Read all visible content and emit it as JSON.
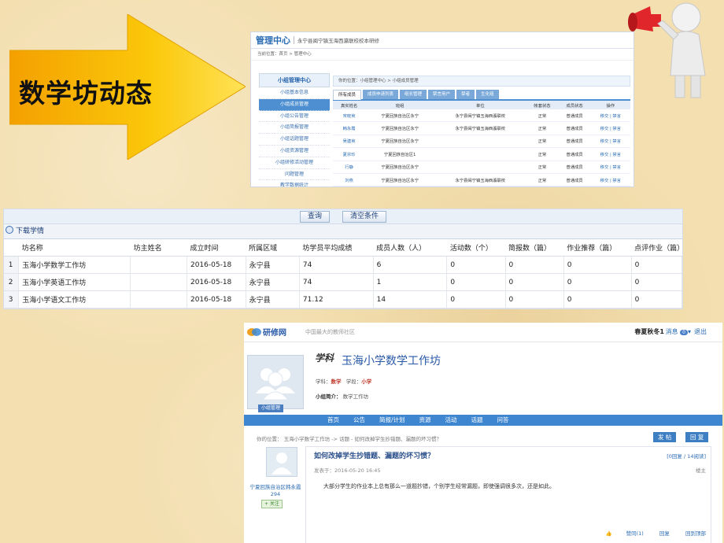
{
  "slide": {
    "title": "数学坊动态"
  },
  "panel_admin": {
    "header_title": "管理中心",
    "header_subtitle": "永宁县闽宁镇玉海西瀛联校校本研修",
    "breadcrumb": "当前位置：首页 > 管理中心",
    "sidebar_head": "小组管理中心",
    "sidebar_items": [
      "小组基本信息",
      "小组成员管理",
      "小组公告管理",
      "小组简报管理",
      "小组话题管理",
      "小组资源管理",
      "小组研修活动管理",
      "问题管理",
      "教学数据统计"
    ],
    "location": "你的位置：小组管理中心 > 小组成员管理",
    "tabs": [
      "所有成员",
      "成员申请列表",
      "组长管理",
      "禁言用户",
      "禁者",
      "生化组"
    ],
    "columns": [
      "真实姓名",
      "班组",
      "单位",
      "帐套状态",
      "成员状态",
      "操作"
    ],
    "rows": [
      {
        "name": "宋晓英",
        "dept": "宁夏回族自治区永宁",
        "org": "永宁县闽宁镇玉海西瀛联校",
        "status": "正常",
        "role": "普通成员",
        "op": "移交 | 禁言"
      },
      {
        "name": "韩永霞",
        "dept": "宁夏回族自治区永宁",
        "org": "永宁县闽宁镇玉海西瀛联校",
        "status": "正常",
        "role": "普通成员",
        "op": "移交 | 禁言"
      },
      {
        "name": "吴建英",
        "dept": "宁夏回族自治区永宁",
        "org": "",
        "status": "正常",
        "role": "普通成员",
        "op": "移交 | 禁言"
      },
      {
        "name": "夏宗珍",
        "dept": "宁夏回族自治区1",
        "org": "",
        "status": "正常",
        "role": "普通成员",
        "op": "移交 | 禁言"
      },
      {
        "name": "行静",
        "dept": "宁夏回族自治区永宁",
        "org": "",
        "status": "正常",
        "role": "普通成员",
        "op": "移交 | 禁言"
      },
      {
        "name": "刘燕",
        "dept": "宁夏回族自治区永宁",
        "org": "永宁县闽宁镇玉海西瀛联校",
        "status": "正常",
        "role": "普通成员",
        "op": "移交 | 禁言"
      }
    ]
  },
  "panel_stats": {
    "query_btn": "查询",
    "clear_btn": "清空条件",
    "download_btn": "下载学情",
    "columns": [
      "坊名称",
      "坊主姓名",
      "成立时间",
      "所属区域",
      "坊学员平均成绩",
      "成员人数（人）",
      "活动数（个）",
      "简报数（篇）",
      "作业推荐（篇）",
      "点评作业（篇）"
    ],
    "rows": [
      {
        "no": "1",
        "name": "玉海小学数学工作坊",
        "owner": "",
        "date": "2016-05-18",
        "region": "永宁县",
        "avg": "74",
        "members": "6",
        "acts": "0",
        "briefs": "0",
        "rec": "0",
        "review": "0"
      },
      {
        "no": "2",
        "name": "玉海小学英语工作坊",
        "owner": "",
        "date": "2016-05-18",
        "region": "永宁县",
        "avg": "74",
        "members": "1",
        "acts": "0",
        "briefs": "0",
        "rec": "0",
        "review": "0"
      },
      {
        "no": "3",
        "name": "玉海小学语文工作坊",
        "owner": "",
        "date": "2016-05-18",
        "region": "永宁县",
        "avg": "71.12",
        "members": "14",
        "acts": "0",
        "briefs": "0",
        "rec": "0",
        "review": "0"
      }
    ]
  },
  "panel_forum": {
    "logo": "研修网",
    "slogan": "中国最大的教师社区",
    "user": "春夏秋冬1",
    "messages": "消息",
    "message_count": "0",
    "logout": "退出",
    "subject_mark": "学科",
    "group_name": "玉海小学数学工作坊",
    "subject_label": "学科：",
    "subject": "数学",
    "stage_label": "学段：",
    "stage": "小学",
    "intro_label": "小组简介：",
    "intro": "数学工作坊",
    "group_manage": "小组管理",
    "nav": [
      "首页",
      "公告",
      "简报/计划",
      "资源",
      "活动",
      "话题",
      "问答"
    ],
    "position": "你的位置： 玉海小学数学工作坊 -> 话题 - 如何改掉学生抄错题、漏题的坏习惯？",
    "post_btn": "发 帖",
    "reply_btn": "回 复",
    "post_title": "如何改掉学生抄错题、漏题的坏习惯？",
    "post_info": "[0回复 / 14阅读]",
    "post_date": "发表于：2016-05-20 16:45",
    "floor": "楼主",
    "author": "宁夏回族自治区韩永霞",
    "author_score": "294",
    "follow": "+ 关注",
    "body": "大部分学生的作业本上总有那么一道题抄错，个别学生经常漏题，即使强调很多次，还是如此。",
    "likes": "赞同(1)",
    "reply": "回复",
    "back_top": "回到顶部"
  }
}
